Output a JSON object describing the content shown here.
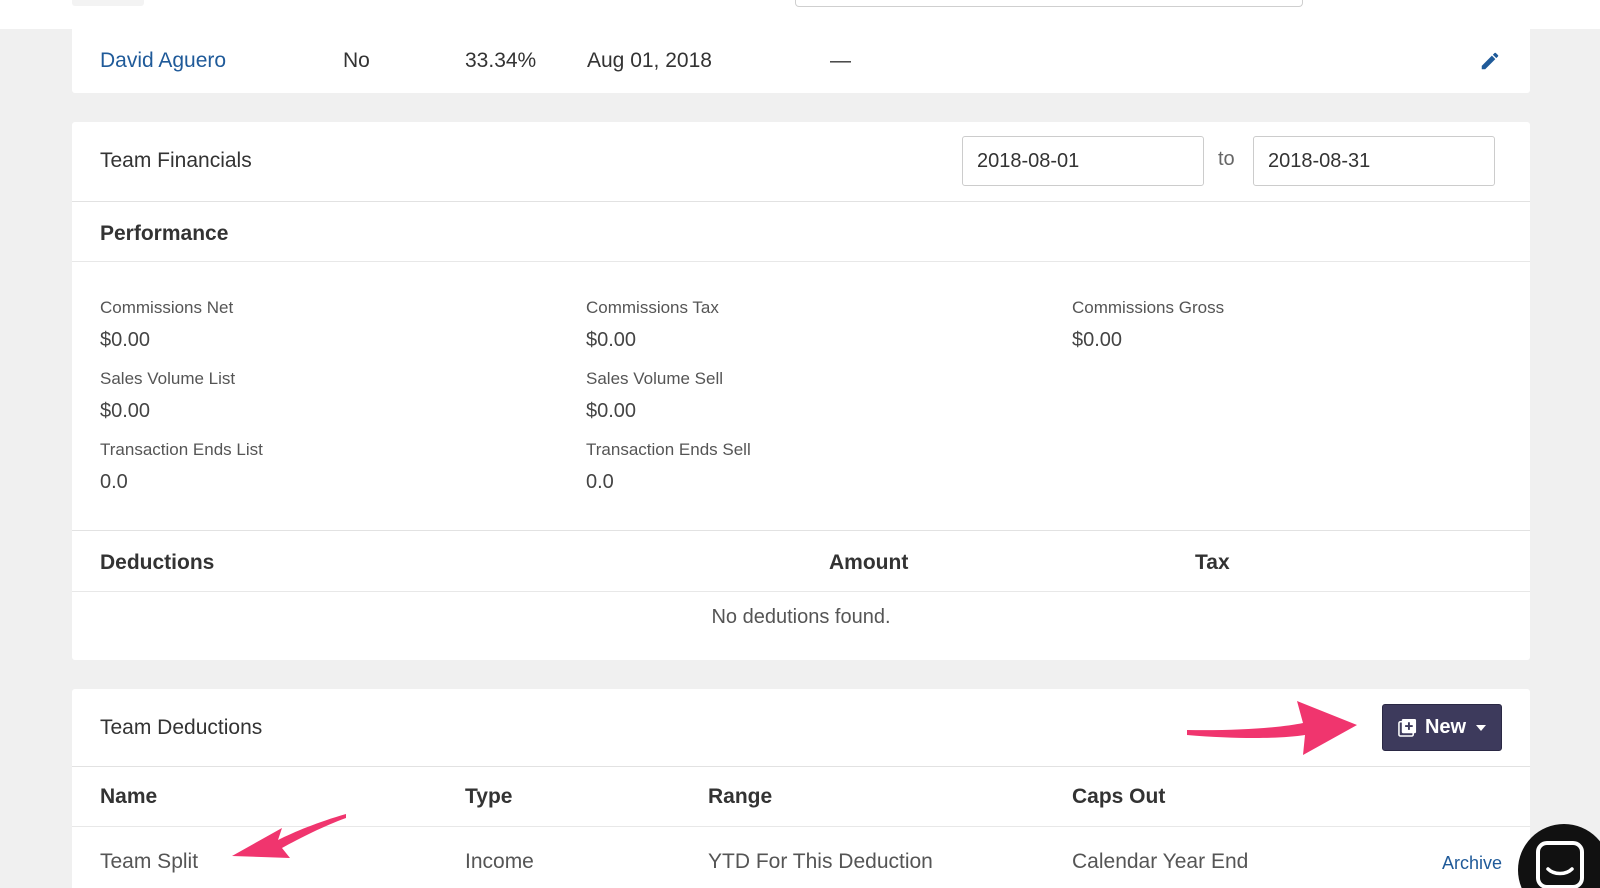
{
  "agent_row": {
    "name": "David Aguero",
    "flag": "No",
    "percent": "33.34%",
    "date": "Aug 01, 2018",
    "end": "—"
  },
  "team_financials": {
    "title": "Team Financials",
    "date_from": "2018-08-01",
    "to_label": "to",
    "date_to": "2018-08-31"
  },
  "performance": {
    "title": "Performance",
    "metrics": [
      {
        "label": "Commissions Net",
        "value": "$0.00"
      },
      {
        "label": "Commissions Tax",
        "value": "$0.00"
      },
      {
        "label": "Commissions Gross",
        "value": "$0.00"
      },
      {
        "label": "Sales Volume List",
        "value": "$0.00"
      },
      {
        "label": "Sales Volume Sell",
        "value": "$0.00"
      },
      {
        "label": "Transaction Ends List",
        "value": "0.0"
      },
      {
        "label": "Transaction Ends Sell",
        "value": "0.0"
      }
    ]
  },
  "deductions": {
    "col_deductions": "Deductions",
    "col_amount": "Amount",
    "col_tax": "Tax",
    "empty_message": "No dedutions found."
  },
  "team_deductions": {
    "title": "Team Deductions",
    "new_button_label": "New",
    "columns": {
      "name": "Name",
      "type": "Type",
      "range": "Range",
      "caps_out": "Caps Out"
    },
    "rows": [
      {
        "name": "Team Split",
        "type": "Income",
        "range": "YTD For This Deduction",
        "caps_out": "Calendar Year End",
        "action": "Archive"
      }
    ]
  },
  "colors": {
    "link": "#1f5a99",
    "button": "#3d3a5c",
    "annotation_arrow": "#f0356e"
  },
  "icons": [
    "pencil-icon",
    "plus-square-icon",
    "caret-down-icon",
    "chat-icon"
  ]
}
